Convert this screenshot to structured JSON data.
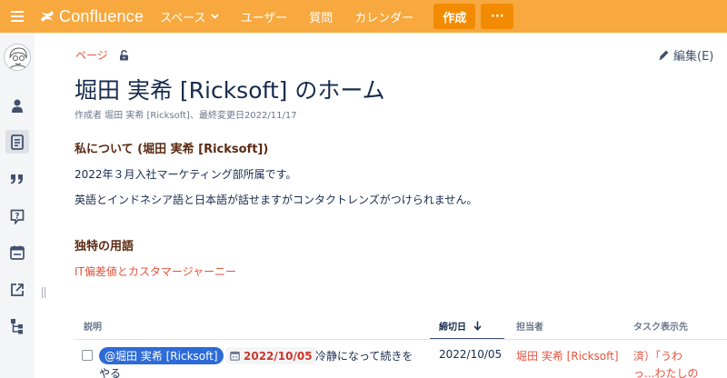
{
  "topbar": {
    "logo_text": "Confluence",
    "nav": [
      {
        "label": "スペース"
      },
      {
        "label": "ユーザー"
      },
      {
        "label": "質問"
      },
      {
        "label": "カレンダー"
      }
    ],
    "create_label": "作成",
    "more_label": "···",
    "bg_color": "#f7a93f",
    "button_color": "#f38b00"
  },
  "page": {
    "breadcrumb": "ページ",
    "edit_label": "編集(E)",
    "title": "堀田 実希 [Ricksoft] のホーム",
    "byline": "作成者 堀田 実希 [Ricksoft]、最終変更日2022/11/17",
    "about_heading": "私について (堀田 実希 [Ricksoft])",
    "about_p1": "2022年３月入社マーケティング部所属です。",
    "about_p2": "英語とインドネシア語と日本語が話せますがコンタクトレンズがつけられません。",
    "terms_heading": "独特の用語",
    "terms_link": "IT偏差値とカスタマージャーニー"
  },
  "tasks": {
    "headers": {
      "description": "説明",
      "due": "締切日",
      "assignee": "担当者",
      "location": "タスク表示先"
    },
    "rows": [
      {
        "mention": "@堀田 実希 [Ricksoft]",
        "date_lozenge": "2022/10/05",
        "text_line1": "冷静になって続きを",
        "text_line2": "やる",
        "due": "2022/10/05",
        "assignee": "堀田 実希 [Ricksoft]",
        "location_line1": "済）「うわ",
        "location_line2": "っ...わたしの"
      }
    ]
  }
}
